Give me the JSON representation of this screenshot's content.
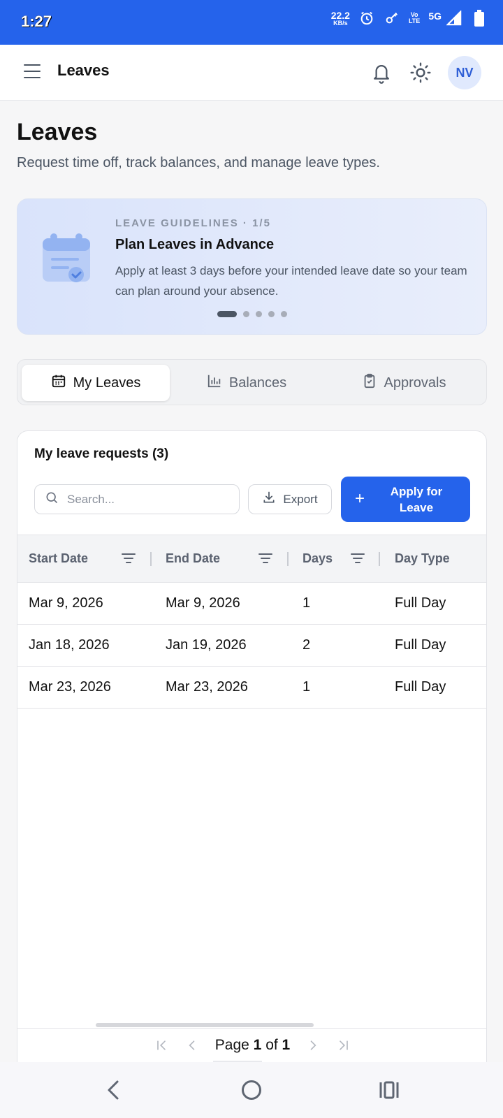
{
  "status_bar": {
    "time": "1:27",
    "net_speed": "22.2",
    "net_unit": "KB/s",
    "volte_top": "Vo",
    "volte_bottom": "LTE",
    "network": "5G"
  },
  "app_bar": {
    "title": "Leaves",
    "avatar_initials": "NV"
  },
  "page": {
    "title": "Leaves",
    "subtitle": "Request time off, track balances, and manage leave types."
  },
  "guidelines": {
    "eyebrow": "LEAVE GUIDELINES · 1/5",
    "title": "Plan Leaves in Advance",
    "body": "Apply at least 3 days before your intended leave date so your team can plan around your absence.",
    "current_slide": 1,
    "total_slides": 5
  },
  "tabs": [
    {
      "label": "My Leaves",
      "icon": "calendar-icon",
      "active": true
    },
    {
      "label": "Balances",
      "icon": "bar-chart-icon",
      "active": false
    },
    {
      "label": "Approvals",
      "icon": "clipboard-check-icon",
      "active": false
    }
  ],
  "panel": {
    "title": "My leave requests (3)",
    "search_placeholder": "Search...",
    "export_label": "Export",
    "apply_label": "Apply for Leave"
  },
  "table": {
    "columns": [
      "Start Date",
      "End Date",
      "Days",
      "Day Type"
    ],
    "rows": [
      [
        "Mar 9, 2026",
        "Mar 9, 2026",
        "1",
        "Full Day"
      ],
      [
        "Jan 18, 2026",
        "Jan 19, 2026",
        "2",
        "Full Day"
      ],
      [
        "Mar 23, 2026",
        "Mar 23, 2026",
        "1",
        "Full Day"
      ]
    ]
  },
  "pager": {
    "prefix": "Page",
    "current": "1",
    "of": "of",
    "total": "1"
  },
  "colors": {
    "accent": "#2563eb",
    "status_bar": "#2563eb",
    "avatar_bg": "#e0e9fd"
  }
}
